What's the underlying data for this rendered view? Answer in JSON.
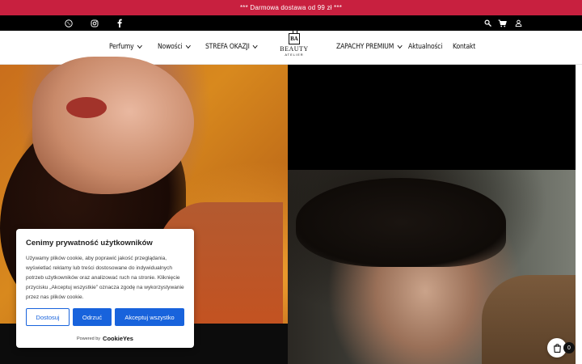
{
  "promo": {
    "text": "*** Darmowa dostawa od 99 zł ***",
    "color": "#c8203f"
  },
  "top_bar": {
    "icons_left": [
      "phone-icon",
      "instagram-icon",
      "facebook-icon"
    ],
    "icons_right": [
      "search-icon",
      "cart-icon",
      "user-icon"
    ]
  },
  "nav": {
    "items": [
      {
        "label": "Perfumy",
        "dropdown": true
      },
      {
        "label": "Nowości",
        "dropdown": true
      },
      {
        "label": "STREFA OKAZJI",
        "dropdown": true
      },
      {
        "label": "ZAPACHY PREMIUM",
        "dropdown": true
      },
      {
        "label": "Aktualności",
        "dropdown": false
      },
      {
        "label": "Kontakt",
        "dropdown": false
      }
    ]
  },
  "logo": {
    "mark": "BA",
    "name": "BEAUTY",
    "sub": "ATELIER"
  },
  "cookie": {
    "title": "Cenimy prywatność użytkowników",
    "text": "Używamy plików cookie, aby poprawić jakość przeglądania, wyświetlać reklamy lub treści dostosowane do indywidualnych potrzeb użytkowników oraz analizować ruch na stronie. Kliknięcie przycisku „Akceptuj wszystkie” oznacza zgodę na wykorzystywanie przez nas plików cookie.",
    "btn_customize": "Dostosuj",
    "btn_reject": "Odrzuć",
    "btn_accept": "Akceptuj wszystko",
    "powered_by": "Powered by",
    "brand": "CookieYes",
    "accent": "#1863dc"
  },
  "cart": {
    "count": "0"
  }
}
